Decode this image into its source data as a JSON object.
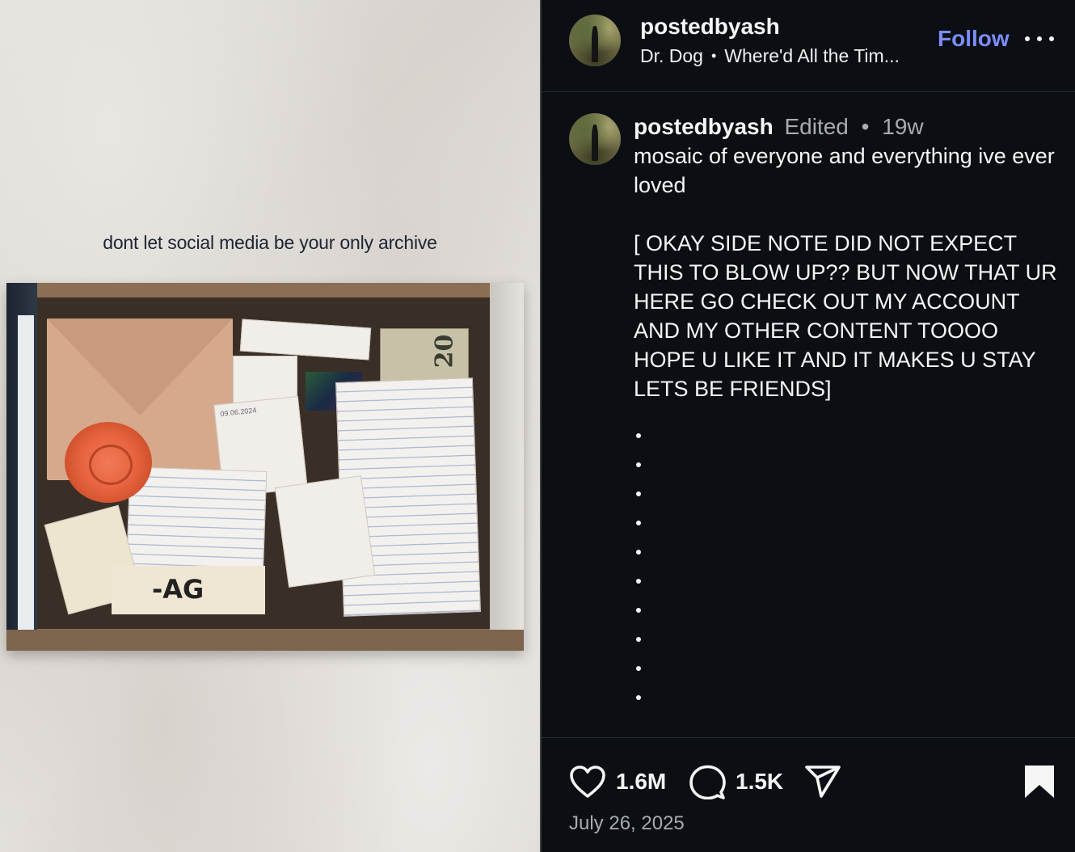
{
  "media": {
    "overlay_text": "dont let social media be your only archive",
    "written_date": "09.06.2024",
    "bill_value": "20",
    "card_initials": "-AG"
  },
  "header": {
    "username": "postedbyash",
    "artist": "Dr. Dog",
    "song": "Where'd All the Tim...",
    "follow_label": "Follow"
  },
  "comment": {
    "username": "postedbyash",
    "edited_label": "Edited",
    "separator": "•",
    "age": "19w",
    "text_line1": "mosaic of everyone and everything ive ever loved",
    "text_line2": "[ OKAY SIDE NOTE DID NOT EXPECT THIS TO BLOW UP?? BUT NOW THAT UR HERE GO CHECK OUT MY ACCOUNT AND MY OTHER CONTENT TOOOO HOPE U LIKE IT AND IT MAKES U STAY LETS BE FRIENDS]",
    "dot_count": 10
  },
  "footer": {
    "likes": "1.6M",
    "comments": "1.5K",
    "date": "July 26, 2025"
  },
  "icons": {
    "like": "heart-icon",
    "comment": "speech-bubble-icon",
    "share": "paper-plane-icon",
    "save": "bookmark-icon",
    "more": "ellipsis-icon"
  },
  "colors": {
    "background": "#0b0f14",
    "follow_accent": "#7c8cf8",
    "muted_text": "#a8acb2"
  }
}
